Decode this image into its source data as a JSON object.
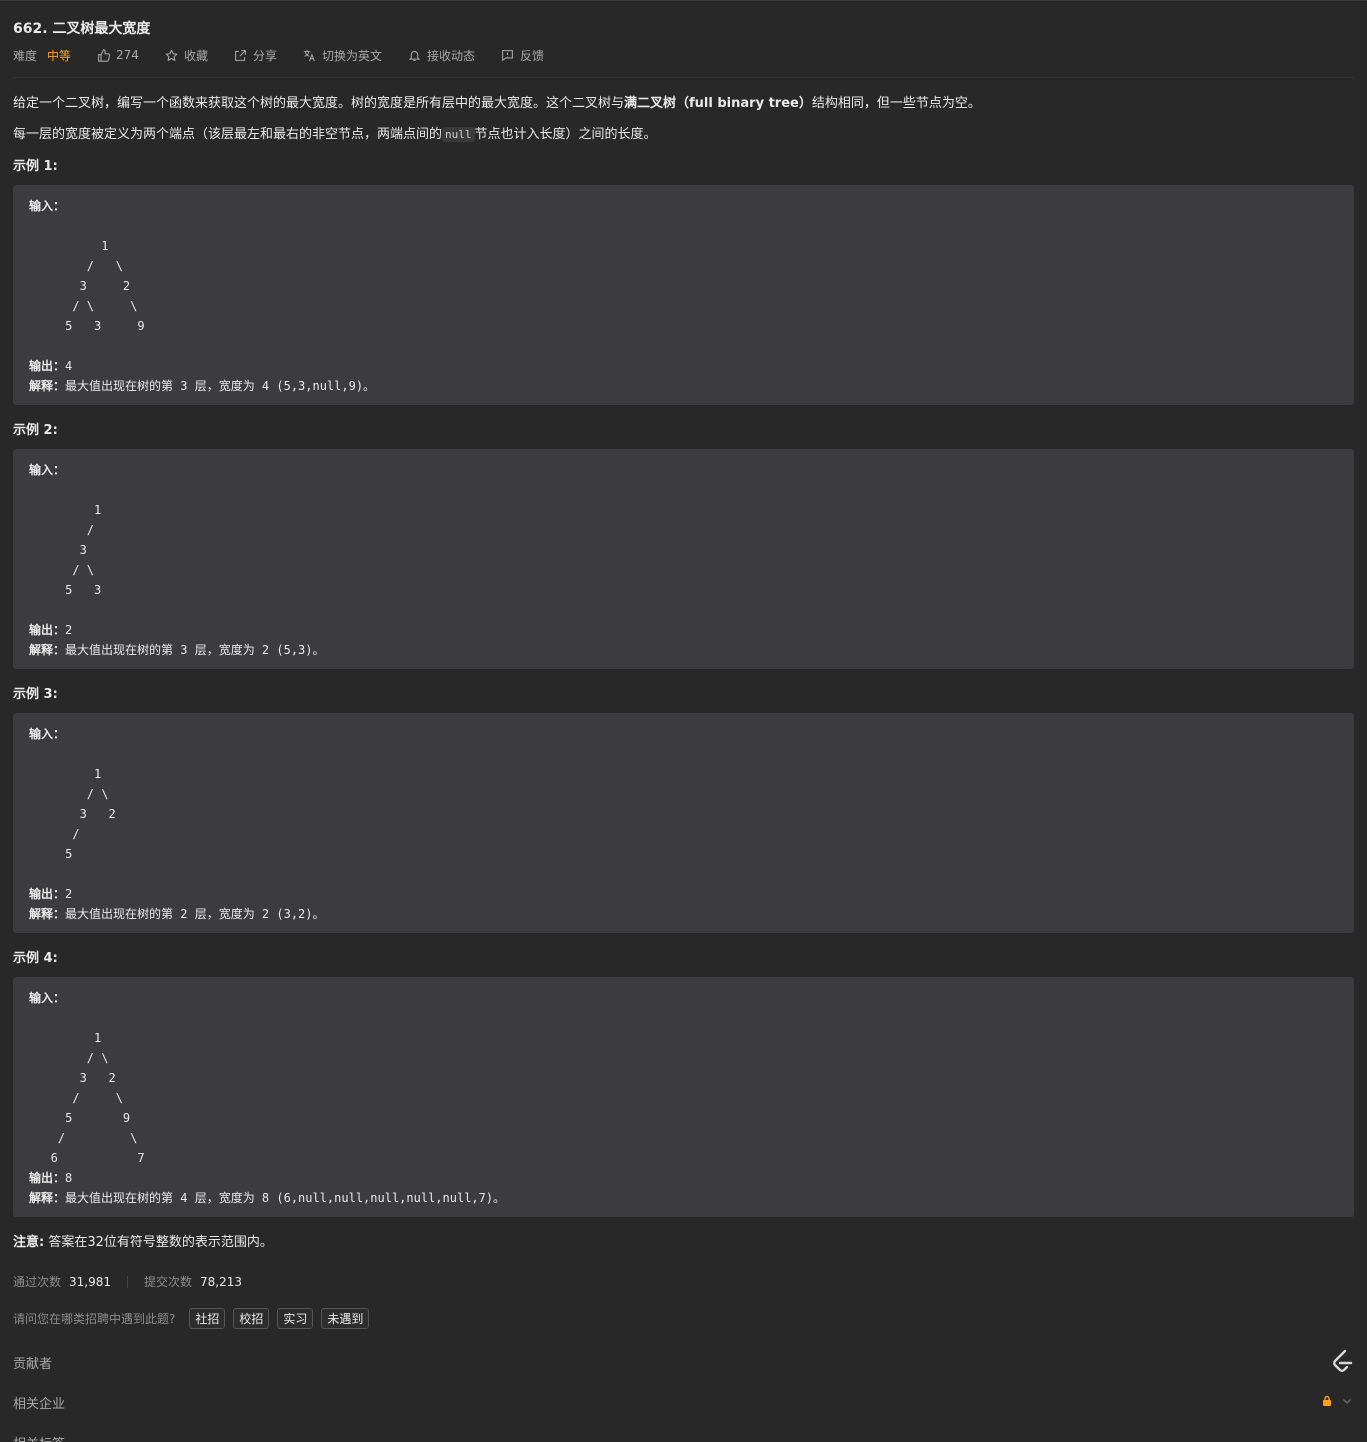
{
  "problem": {
    "title": "662. 二叉树最大宽度"
  },
  "meta": {
    "difficulty_label": "难度",
    "difficulty": "中等",
    "likes": "274",
    "favorite_label": "收藏",
    "share_label": "分享",
    "switch_lang_label": "切换为英文",
    "subscribe_label": "接收动态",
    "feedback_label": "反馈"
  },
  "description": {
    "p1_a": "给定一个二叉树，编写一个函数来获取这个树的最大宽度。树的宽度是所有层中的最大宽度。这个二叉树与",
    "p1_b": "满二叉树（full binary tree）",
    "p1_c": "结构相同，但一些节点为空。",
    "p2_a": "每一层的宽度被定义为两个端点（该层最左和最右的非空节点，两端点间的",
    "p2_code": "null",
    "p2_b": "节点也计入长度）之间的长度。"
  },
  "labels": {
    "input": "输入：",
    "output": "输出：",
    "explain": "解释："
  },
  "examples": [
    {
      "title": "示例 1:",
      "tree": "\n          1\n        /   \\\n       3     2\n      / \\     \\\n     5   3     9\n",
      "output": "4",
      "explain": "最大值出现在树的第 3 层，宽度为 4 (5,3,null,9)。"
    },
    {
      "title": "示例 2:",
      "tree": "\n         1\n        /\n       3\n      / \\\n     5   3\n",
      "output": "2",
      "explain": "最大值出现在树的第 3 层，宽度为 2 (5,3)。"
    },
    {
      "title": "示例 3:",
      "tree": "\n         1\n        / \\\n       3   2\n      /\n     5\n",
      "output": "2",
      "explain": "最大值出现在树的第 2 层，宽度为 2 (3,2)。"
    },
    {
      "title": "示例 4:",
      "tree": "\n         1\n        / \\\n       3   2\n      /     \\\n     5       9\n    /         \\\n   6           7",
      "output": "8",
      "explain": "最大值出现在树的第 4 层，宽度为 8 (6,null,null,null,null,null,7)。"
    }
  ],
  "note": {
    "label": "注意:",
    "text": "答案在32位有符号整数的表示范围内。"
  },
  "stats": {
    "accepted_label": "通过次数",
    "accepted": "31,981",
    "submissions_label": "提交次数",
    "submissions": "78,213"
  },
  "survey": {
    "question": "请问您在哪类招聘中遇到此题?",
    "options": [
      "社招",
      "校招",
      "实习",
      "未遇到"
    ]
  },
  "sections": {
    "contributors": "贡献者",
    "companies": "相关企业",
    "tags": "相关标签"
  },
  "colors": {
    "background": "#282828",
    "code_block": "#3c3c3e",
    "difficulty_medium": "#ffa116",
    "lock": "#ffa116"
  }
}
